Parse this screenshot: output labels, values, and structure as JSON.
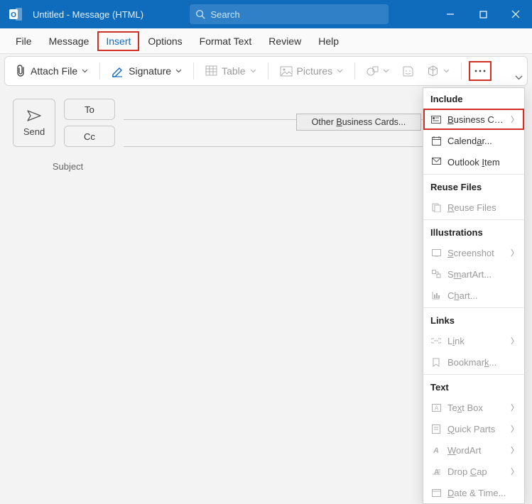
{
  "titlebar": {
    "title": "Untitled  -  Message (HTML)",
    "search_placeholder": "Search"
  },
  "menu": {
    "file": "File",
    "message": "Message",
    "insert": "Insert",
    "options": "Options",
    "format": "Format Text",
    "review": "Review",
    "help": "Help"
  },
  "ribbon": {
    "attach": "Attach File",
    "signature": "Signature",
    "table": "Table",
    "pictures": "Pictures"
  },
  "compose": {
    "send": "Send",
    "to": "To",
    "cc": "Cc",
    "subject": "Subject"
  },
  "submenu": {
    "other_business_cards": "Other Business Cards..."
  },
  "panel": {
    "include": "Include",
    "business_card": "Business Card",
    "calendar": "Calendar...",
    "outlook_item": "Outlook Item",
    "reuse_files_h": "Reuse Files",
    "reuse_files": "Reuse Files",
    "illustrations": "Illustrations",
    "screenshot": "Screenshot",
    "smartart": "SmartArt...",
    "chart": "Chart...",
    "links": "Links",
    "link": "Link",
    "bookmark": "Bookmark...",
    "text": "Text",
    "text_box": "Text Box",
    "quick_parts": "Quick Parts",
    "wordart": "WordArt",
    "drop_cap": "Drop Cap",
    "date_time": "Date & Time..."
  }
}
